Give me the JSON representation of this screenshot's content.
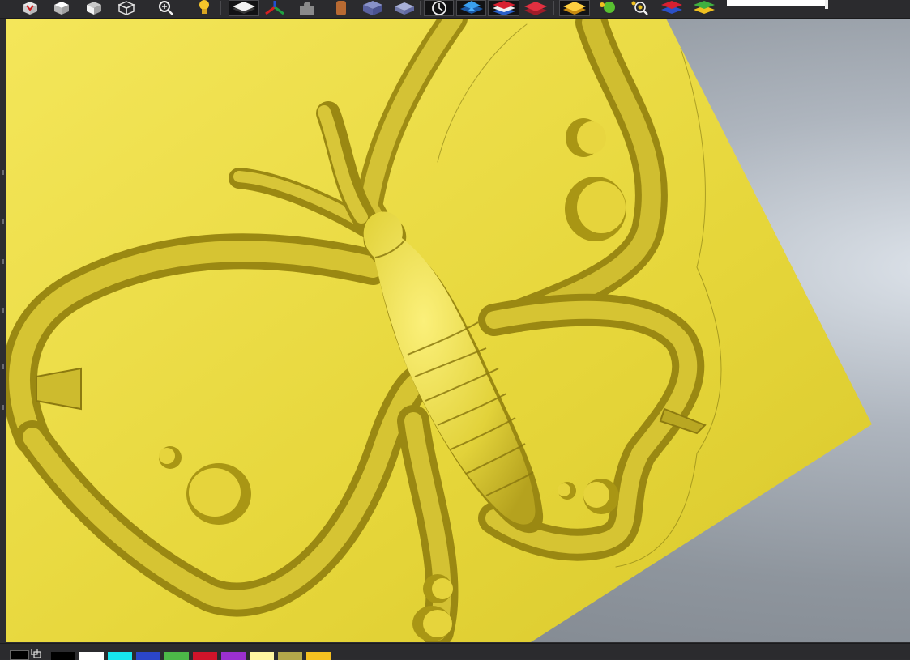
{
  "toolbar": {
    "buttons": [
      {
        "name": "view-iso-icon",
        "active": false
      },
      {
        "name": "view-top-icon",
        "active": false
      },
      {
        "name": "view-front-icon",
        "active": false
      },
      {
        "name": "view-side-icon",
        "active": false
      },
      {
        "name": "zoom-icon",
        "active": false
      },
      {
        "name": "light-bulb-icon",
        "active": false
      },
      {
        "name": "layer-white-icon",
        "active": true
      },
      {
        "name": "axes-icon",
        "active": false
      },
      {
        "name": "puzzle-icon",
        "active": false
      },
      {
        "name": "cylinder-icon",
        "active": false
      },
      {
        "name": "solid-box-icon",
        "active": false
      },
      {
        "name": "wire-box-icon",
        "active": false
      },
      {
        "name": "clock-icon",
        "active": true
      },
      {
        "name": "blue-layers-icon",
        "active": true
      },
      {
        "name": "red-blue-layers-icon",
        "active": true
      },
      {
        "name": "red-layers-icon",
        "active": false
      },
      {
        "name": "yellow-layer-icon",
        "active": true
      },
      {
        "name": "green-dot-icon",
        "active": false
      },
      {
        "name": "zoom-target-icon",
        "active": false
      },
      {
        "name": "red-blue-stack-icon",
        "active": false
      },
      {
        "name": "green-yellow-stack-icon",
        "active": false
      }
    ],
    "progress": 1.0
  },
  "viewport": {
    "background": "#9aa1a9",
    "model_color": "#e8d838",
    "model_name": "butterfly-relief"
  },
  "palette": {
    "primary": "#000000",
    "secondary": "#ffffff",
    "swatches": [
      "#000000",
      "#ffffff",
      "#17e6ee",
      "#2b46c8",
      "#4cb848",
      "#d0142a",
      "#9b30d0",
      "#fff6a0",
      "#b4a84a",
      "#f6c020"
    ]
  }
}
